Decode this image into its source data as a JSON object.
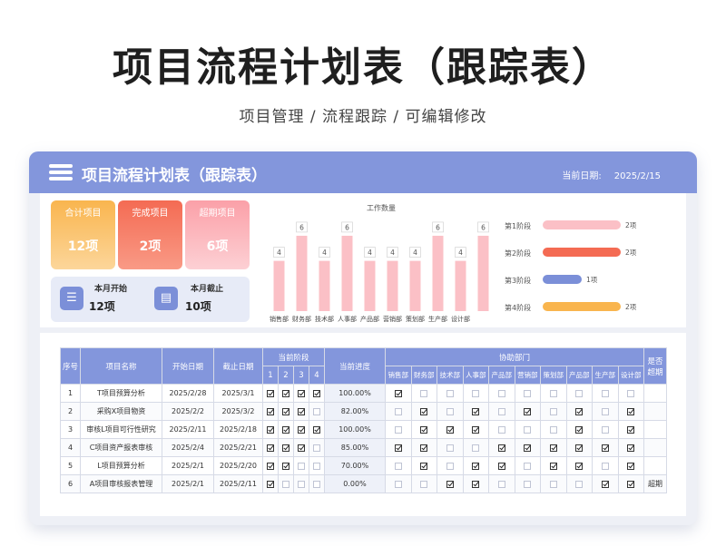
{
  "page": {
    "title": "项目流程计划表（跟踪表）",
    "subtitle": "项目管理 /  流程跟踪  /  可编辑修改"
  },
  "header": {
    "title": "项目流程计划表（跟踪表）",
    "date_label": "当前日期:",
    "date_value": "2025/2/15",
    "menu_icon": "menu-icon"
  },
  "kpis": [
    {
      "label": "合计项目",
      "value": "12项"
    },
    {
      "label": "完成项目",
      "value": "2项"
    },
    {
      "label": "超期项目",
      "value": "6项"
    }
  ],
  "month": [
    {
      "label": "本月开始",
      "value": "12项",
      "icon": "document-icon"
    },
    {
      "label": "本月截止",
      "value": "10项",
      "icon": "layers-icon"
    }
  ],
  "colors": {
    "accent": "#8396dc",
    "bar": "#fbc0c6",
    "stage1": "#fbc0c6",
    "stage2": "#f46b53",
    "stage3": "#7b8fd8",
    "stage4": "#f9b54e"
  },
  "chart_data": [
    {
      "type": "bar",
      "title": "工作数量",
      "categories": [
        "销售部",
        "财务部",
        "技术部",
        "人事部",
        "产品部",
        "营销部",
        "策划部",
        "生产部",
        "设计部"
      ],
      "values": [
        4,
        6,
        4,
        6,
        4,
        4,
        4,
        6,
        4,
        6
      ],
      "ylim": [
        0,
        6.5
      ]
    },
    {
      "type": "bar",
      "orientation": "horizontal",
      "categories": [
        "第1阶段",
        "第2阶段",
        "第3阶段",
        "第4阶段"
      ],
      "values": [
        2,
        2,
        1,
        2
      ],
      "labels": [
        "2项",
        "2项",
        "1项",
        "2项"
      ],
      "xlim": [
        0,
        2
      ]
    }
  ],
  "table": {
    "headers": {
      "seq": "序号",
      "name": "项目名称",
      "start": "开始日期",
      "end": "截止日期",
      "stage": "当前阶段",
      "progress": "当前进度",
      "dept": "协助部门",
      "overdue": "是否超期"
    },
    "stage_cols": [
      "1",
      "2",
      "3",
      "4"
    ],
    "dept_cols": [
      "销售部",
      "财务部",
      "技术部",
      "人事部",
      "产品部",
      "营销部",
      "策划部",
      "产品部",
      "生产部",
      "设计部"
    ],
    "rows": [
      {
        "seq": "1",
        "name": "T项目预算分析",
        "start": "2025/2/28",
        "end": "2025/3/1",
        "stages": [
          1,
          1,
          1,
          1
        ],
        "progress": "100.00%",
        "depts": [
          1,
          0,
          0,
          0,
          0,
          0,
          0,
          0,
          0,
          0
        ],
        "overdue": ""
      },
      {
        "seq": "2",
        "name": "采购X项目物资",
        "start": "2025/2/2",
        "end": "2025/3/2",
        "stages": [
          1,
          1,
          1,
          0
        ],
        "progress": "82.00%",
        "depts": [
          0,
          1,
          0,
          1,
          0,
          1,
          0,
          1,
          0,
          1
        ],
        "overdue": ""
      },
      {
        "seq": "3",
        "name": "审核L项目可行性研究",
        "start": "2025/2/11",
        "end": "2025/2/18",
        "stages": [
          1,
          1,
          1,
          1
        ],
        "progress": "100.00%",
        "depts": [
          0,
          1,
          1,
          1,
          0,
          0,
          0,
          1,
          0,
          1
        ],
        "overdue": ""
      },
      {
        "seq": "4",
        "name": "C项目资产报表审核",
        "start": "2025/2/4",
        "end": "2025/2/21",
        "stages": [
          1,
          1,
          1,
          0
        ],
        "progress": "85.00%",
        "depts": [
          1,
          1,
          0,
          0,
          1,
          1,
          1,
          1,
          1,
          1
        ],
        "overdue": ""
      },
      {
        "seq": "5",
        "name": "L项目预算分析",
        "start": "2025/2/1",
        "end": "2025/2/20",
        "stages": [
          1,
          1,
          0,
          0
        ],
        "progress": "70.00%",
        "depts": [
          0,
          1,
          0,
          1,
          1,
          0,
          1,
          1,
          0,
          1
        ],
        "overdue": ""
      },
      {
        "seq": "6",
        "name": "A项目审核报表管理",
        "start": "2025/2/1",
        "end": "2025/2/11",
        "stages": [
          1,
          0,
          0,
          0
        ],
        "progress": "0.00%",
        "depts": [
          0,
          0,
          1,
          1,
          0,
          0,
          0,
          0,
          1,
          1
        ],
        "overdue": "超期"
      }
    ]
  }
}
